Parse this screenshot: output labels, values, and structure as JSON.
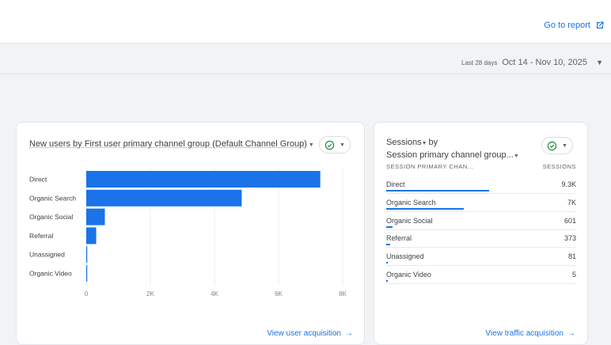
{
  "header": {
    "go_to_report": "Go to report",
    "go_to_report_icon": "external-link-icon"
  },
  "date_range": {
    "label": "Last 28 days",
    "value": "Oct 14 - Nov 10, 2025"
  },
  "new_users_card": {
    "title": "New users by First user primary channel group (Default Channel Group)",
    "view_link": "View user acquisition",
    "chart_data": {
      "type": "bar",
      "orientation": "horizontal",
      "categories": [
        "Direct",
        "Organic Search",
        "Organic Social",
        "Referral",
        "Unassigned",
        "Organic Video"
      ],
      "values": [
        7300,
        4850,
        580,
        310,
        20,
        5
      ],
      "xlim": [
        0,
        8000
      ],
      "x_ticks": [
        "0",
        "2K",
        "4K",
        "6K",
        "8K"
      ],
      "bar_color": "#1a73e8"
    }
  },
  "sessions_card": {
    "title_line1": "Sessions",
    "title_by": "by",
    "title_line2": "Session primary channel group...",
    "col_dimension": "SESSION PRIMARY CHAN...",
    "col_metric": "SESSIONS",
    "view_link": "View traffic acquisition",
    "max_value": 9300,
    "rows": [
      {
        "name": "Direct",
        "value": "9.3K",
        "n": 9300
      },
      {
        "name": "Organic Search",
        "value": "7K",
        "n": 7000
      },
      {
        "name": "Organic Social",
        "value": "601",
        "n": 601
      },
      {
        "name": "Referral",
        "value": "373",
        "n": 373
      },
      {
        "name": "Unassigned",
        "value": "81",
        "n": 81
      },
      {
        "name": "Organic Video",
        "value": "5",
        "n": 5
      }
    ]
  }
}
